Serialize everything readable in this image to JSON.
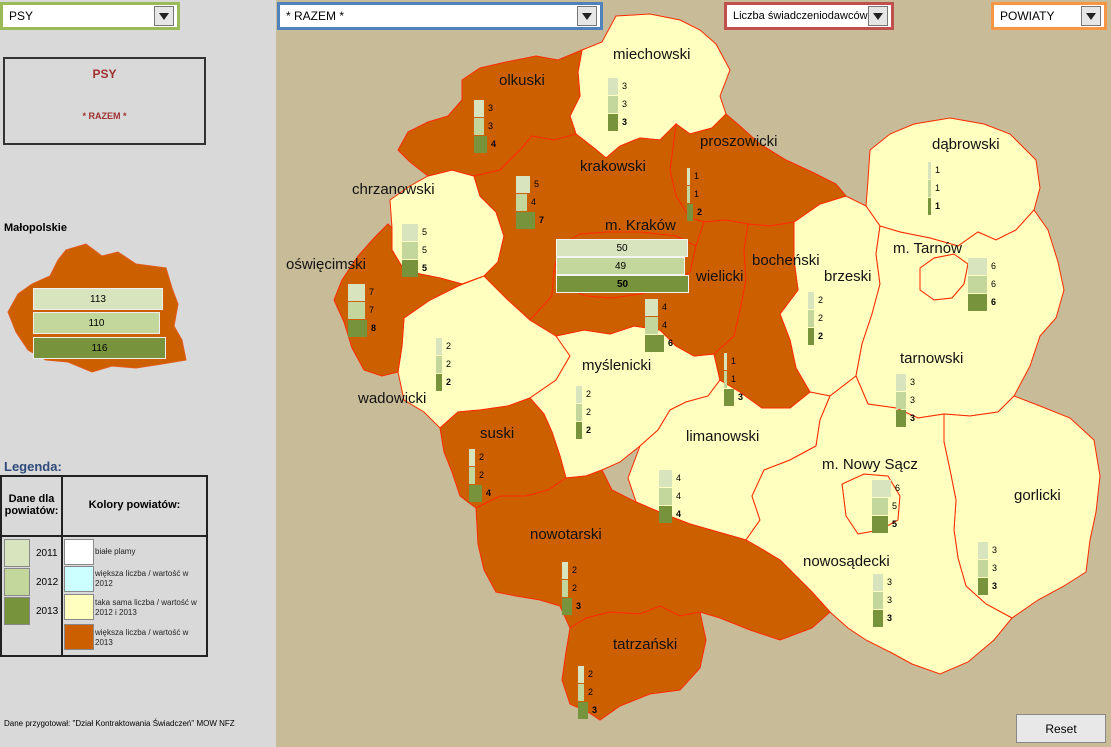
{
  "dropdowns": {
    "species": {
      "value": "PSY"
    },
    "category": {
      "value": "* RAZEM *"
    },
    "measure": {
      "value": "Liczba świadczeniodawców"
    },
    "level": {
      "value": "POWIATY"
    }
  },
  "title_box": {
    "line1": "PSY",
    "line2": "* RAZEM *"
  },
  "region": {
    "name": "Małopolskie",
    "values": {
      "2011": 113,
      "2012": 110,
      "2013": 116
    }
  },
  "legend": {
    "title": "Legenda:",
    "header_data": "Dane dla powiatów:",
    "header_colors": "Kolory powiatów:",
    "years": [
      {
        "label": "2011",
        "color": "#d7e4bd"
      },
      {
        "label": "2012",
        "color": "#c3d69b"
      },
      {
        "label": "2013",
        "color": "#77933c"
      }
    ],
    "colors": [
      {
        "label": "białe plamy",
        "color": "#ffffff"
      },
      {
        "label": "większa liczba / wartość w 2012",
        "color": "#ccffff"
      },
      {
        "label": "taka sama liczba / wartość w 2012 i 2013",
        "color": "#ffffc0"
      },
      {
        "label": "większa liczba / wartość w 2013",
        "color": "#cc6000"
      }
    ]
  },
  "footer": "Dane przygotował: \"Dział Kontraktowania Świadczeń\" MOW NFZ",
  "reset_label": "Reset",
  "map_colors": {
    "higher_2013": "#cc6000",
    "same": "#ffffc0",
    "background": "#c8bb97",
    "border": "#ff2a00"
  },
  "districts": [
    {
      "id": "miechowski",
      "name": "miechowski",
      "values": [
        3,
        3,
        3
      ],
      "status": "same"
    },
    {
      "id": "olkuski",
      "name": "olkuski",
      "values": [
        3,
        3,
        4
      ],
      "status": "higher_2013"
    },
    {
      "id": "proszowicki",
      "name": "proszowicki",
      "values": [
        1,
        1,
        2
      ],
      "status": "higher_2013"
    },
    {
      "id": "krakowski",
      "name": "krakowski",
      "values": [
        5,
        4,
        7
      ],
      "status": "higher_2013"
    },
    {
      "id": "dabrowski",
      "name": "dąbrowski",
      "values": [
        1,
        1,
        1
      ],
      "status": "same"
    },
    {
      "id": "chrzanowski",
      "name": "chrzanowski",
      "values": [
        5,
        5,
        5
      ],
      "status": "same"
    },
    {
      "id": "m-krakow",
      "name": "m. Kraków",
      "values": [
        50,
        49,
        50
      ],
      "status": "higher_2013"
    },
    {
      "id": "m-tarnow",
      "name": "m. Tarnów",
      "values": [
        6,
        6,
        6
      ],
      "status": "same"
    },
    {
      "id": "oswiecimski",
      "name": "oświęcimski",
      "values": [
        7,
        7,
        8
      ],
      "status": "higher_2013"
    },
    {
      "id": "wielicki",
      "name": "wielicki",
      "values": [
        4,
        4,
        6
      ],
      "status": "higher_2013"
    },
    {
      "id": "bochenski",
      "name": "bocheński",
      "values": [
        1,
        1,
        3
      ],
      "status": "higher_2013"
    },
    {
      "id": "brzeski",
      "name": "brzeski",
      "values": [
        2,
        2,
        2
      ],
      "status": "same"
    },
    {
      "id": "wadowicki",
      "name": "wadowicki",
      "values": [
        2,
        2,
        2
      ],
      "status": "same"
    },
    {
      "id": "myslenicki",
      "name": "myślenicki",
      "values": [
        2,
        2,
        2
      ],
      "status": "same"
    },
    {
      "id": "tarnowski",
      "name": "tarnowski",
      "values": [
        3,
        3,
        3
      ],
      "status": "same"
    },
    {
      "id": "suski",
      "name": "suski",
      "values": [
        2,
        2,
        4
      ],
      "status": "higher_2013"
    },
    {
      "id": "limanowski",
      "name": "limanowski",
      "values": [
        4,
        4,
        4
      ],
      "status": "same"
    },
    {
      "id": "m-nowy-sacz",
      "name": "m. Nowy Sącz",
      "values": [
        6,
        5,
        5
      ],
      "status": "same"
    },
    {
      "id": "gorlicki",
      "name": "gorlicki",
      "values": [
        3,
        3,
        3
      ],
      "status": "same"
    },
    {
      "id": "nowotarski",
      "name": "nowotarski",
      "values": [
        2,
        2,
        3
      ],
      "status": "higher_2013"
    },
    {
      "id": "nowosadecki",
      "name": "nowosądecki",
      "values": [
        3,
        3,
        3
      ],
      "status": "same"
    },
    {
      "id": "tatrzanski",
      "name": "tatrzański",
      "values": [
        2,
        2,
        3
      ],
      "status": "higher_2013"
    }
  ]
}
